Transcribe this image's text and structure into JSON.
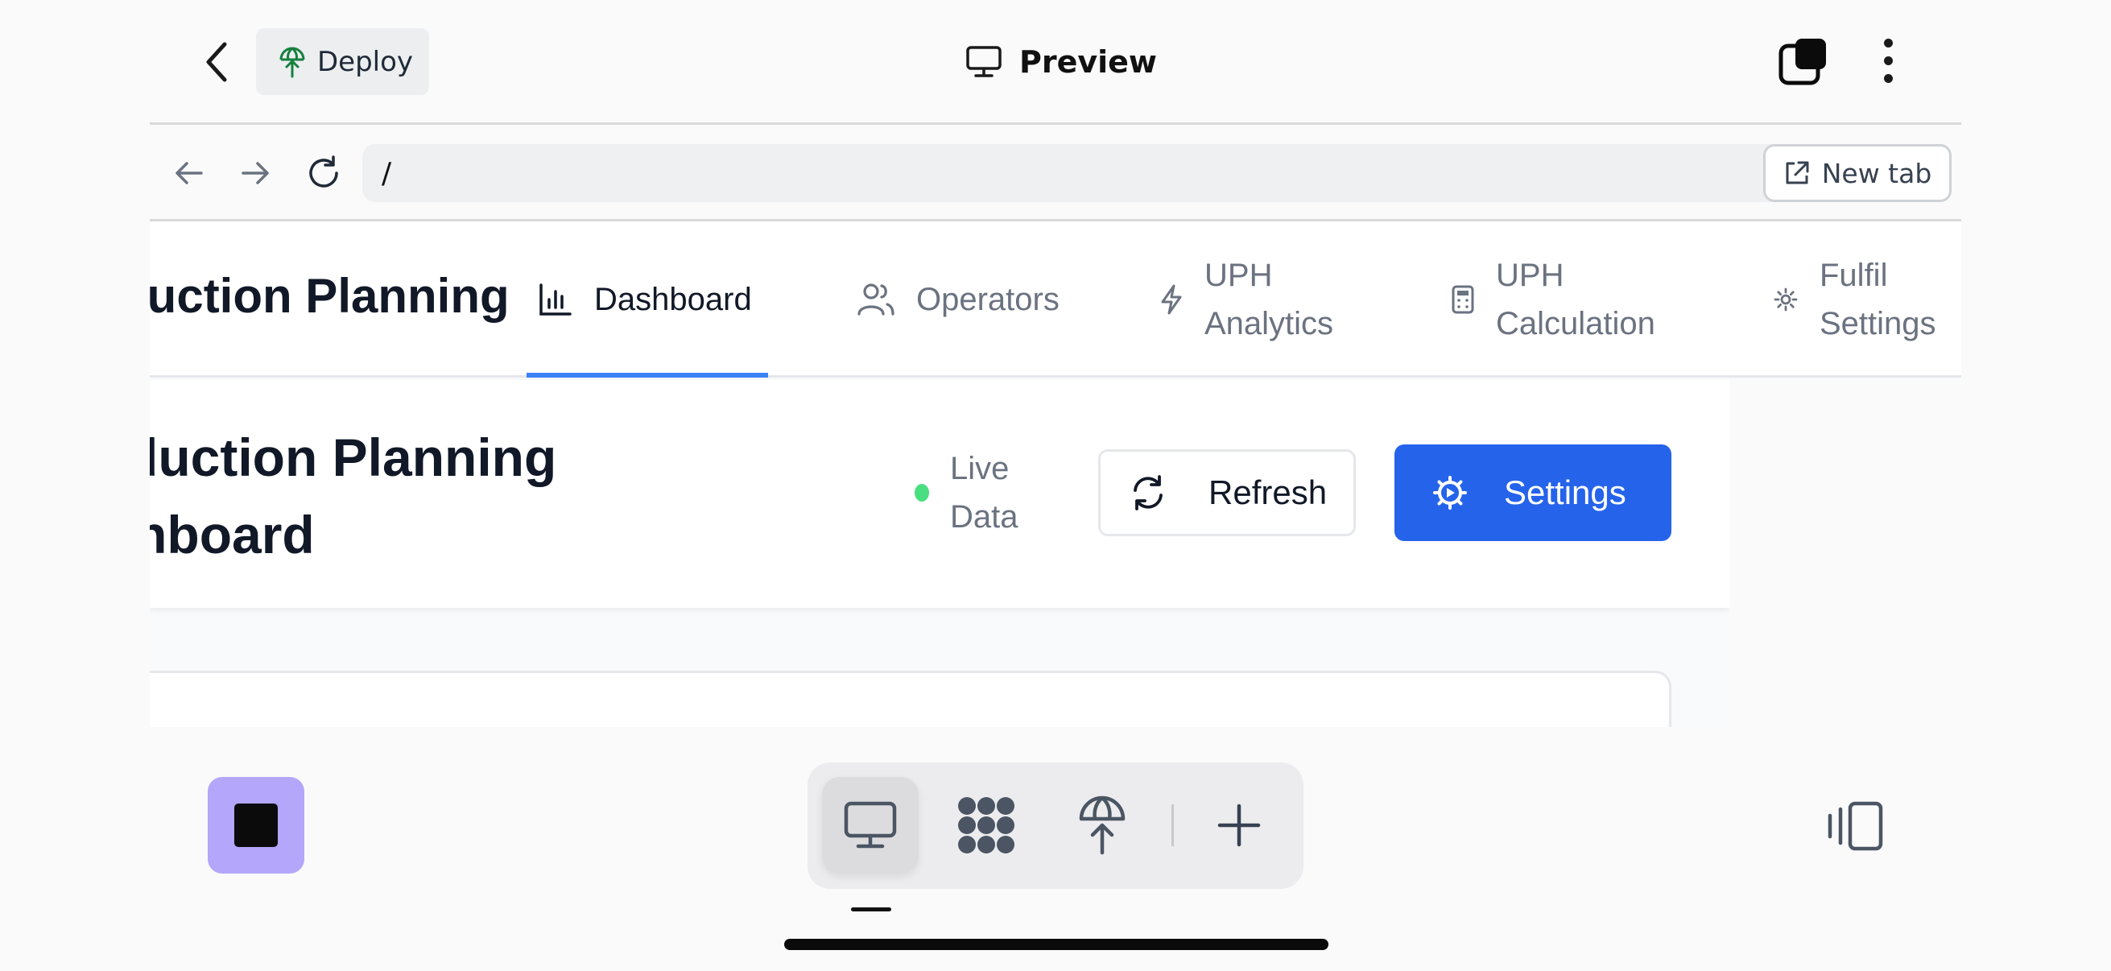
{
  "topbar": {
    "deploy_label": "Deploy",
    "title": "Preview",
    "icons": [
      "chevron-left-icon",
      "deploy-icon",
      "monitor-icon",
      "tabs-icon",
      "more-vertical-icon"
    ]
  },
  "browser": {
    "url": "/",
    "new_tab_label": "New tab",
    "icons": [
      "arrow-left-icon",
      "arrow-right-icon",
      "reload-icon",
      "go-arrow-icon",
      "external-link-icon"
    ]
  },
  "app": {
    "brand": "Production Planning",
    "nav": [
      {
        "label": "Dashboard",
        "icon": "bar-chart-icon",
        "active": true
      },
      {
        "label": "Operators",
        "icon": "users-icon",
        "active": false
      },
      {
        "label": "UPH Analytics",
        "icon": "zap-icon",
        "active": false
      },
      {
        "label": "UPH Calculation",
        "icon": "calculator-icon",
        "active": false
      },
      {
        "label": "Fulfil Settings",
        "icon": "gear-icon",
        "active": false
      }
    ],
    "page_title": "Production Planning Dashboard",
    "live_label": "Live Data",
    "refresh_label": "Refresh",
    "settings_label": "Settings",
    "colors": {
      "primary": "#2563eb",
      "live": "#4ade80",
      "accent": "#3b82f6"
    }
  },
  "bottom": {
    "stop_color": "#b3a6fb",
    "dock_icons": [
      "monitor-icon",
      "workflow-icon",
      "deploy-icon",
      "plus-icon"
    ],
    "side_panel_icon": "side-panel-icon"
  }
}
